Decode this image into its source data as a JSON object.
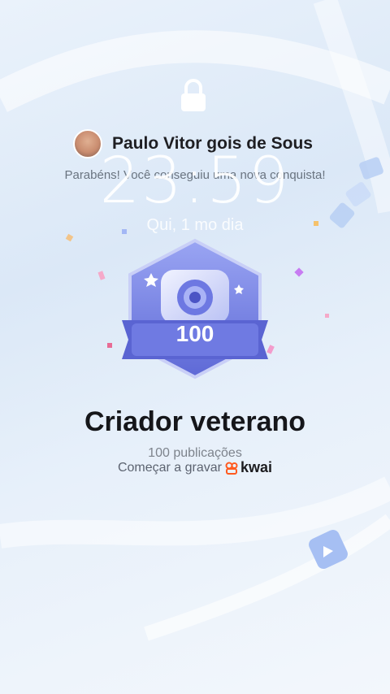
{
  "lockscreen": {
    "time": "23:59",
    "date": "Qui, 1 mo dia"
  },
  "notification": {
    "user_name": "Paulo Vitor gois de Sous",
    "message": "Parabéns! Você conseguiu uma nova conquista!"
  },
  "achievement": {
    "badge_number": "100",
    "title": "Criador veterano",
    "subtitle": "100 publicações",
    "cta": "Começar a gravar",
    "brand": "kwai"
  },
  "colors": {
    "badge_primary": "#7b86e8",
    "badge_dark": "#4d57c9",
    "brand_orange": "#ff5a1f"
  },
  "icons": [
    "lock-icon",
    "camera-icon",
    "star-icon",
    "kwai-logo-icon",
    "play-icon"
  ]
}
